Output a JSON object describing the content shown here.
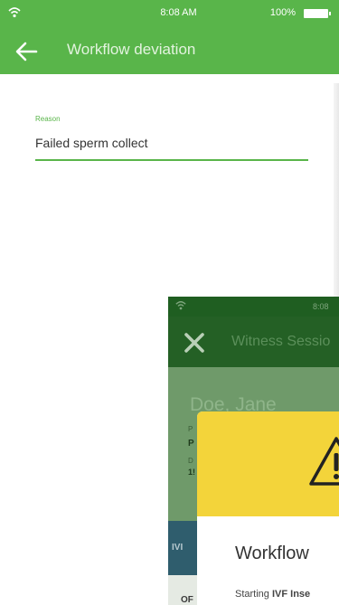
{
  "status_bar": {
    "time": "8:08 AM",
    "battery": "100%"
  },
  "app_bar": {
    "title": "Workflow deviation",
    "back_icon": "arrow-left-icon"
  },
  "form": {
    "reason_label": "Reason",
    "reason_value": "Failed sperm collect"
  },
  "overlay": {
    "status_time": "8:08",
    "title": "Witness Sessio",
    "close_icon": "close-icon",
    "patient_name": "Doe, Jane",
    "field1_label": "P",
    "field1_value": "P",
    "field2_label": "D",
    "field2_value": "1!",
    "strip_text": "IVI",
    "bottom_text": "OF"
  },
  "dialog": {
    "icon": "warning-icon",
    "title": "Workflow",
    "text_prefix": "Starting ",
    "text_bold": "IVF Inse"
  },
  "colors": {
    "primary": "#59b54a",
    "warning": "#f3d43a",
    "overlay_dark": "#2b6b2c"
  }
}
